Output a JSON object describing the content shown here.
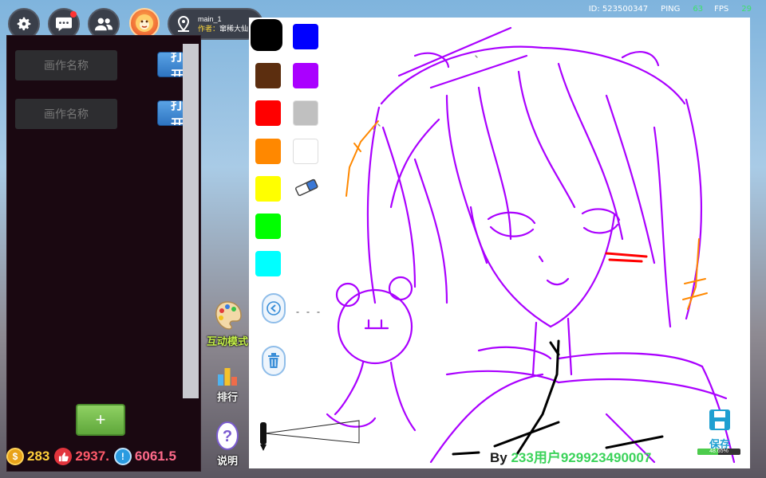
{
  "topbar": {
    "id_label": "ID: 523500347",
    "ping_label": "PING",
    "ping_value": "63",
    "fps_label": "FPS",
    "fps_value": "29"
  },
  "nav_icons": [
    "gear-icon",
    "chat-icon",
    "friends-icon"
  ],
  "map": {
    "name": "main_1",
    "author_label": "作者：",
    "author": "窜稀大仙"
  },
  "paintings_panel": {
    "items": [
      {
        "placeholder": "画作名称",
        "open_label": "打开"
      },
      {
        "placeholder": "画作名称",
        "open_label": "打开"
      }
    ],
    "add_label": "+"
  },
  "currency": {
    "coins": "283",
    "likes": "2937.",
    "score": "6061.5"
  },
  "side_tools": {
    "interact_label": "互动模式",
    "rank_label": "排行",
    "help_label": "说明"
  },
  "palette": {
    "colors": [
      "#000000",
      "#0000ff",
      "#5c2e0f",
      "#aa00ff",
      "#ff0000",
      "#c0c0c0",
      "#ff8800",
      "#ffffff",
      "#ffff00",
      "#00ff00",
      "#00ffff"
    ],
    "selected": "#000000"
  },
  "canvas": {
    "byline_prefix": "By ",
    "byline_user": "233用户929923490007",
    "save_label": "保存",
    "save_progress_text": "48.65%",
    "save_progress": 0.4865,
    "stroke_color": "#aa00ff"
  }
}
